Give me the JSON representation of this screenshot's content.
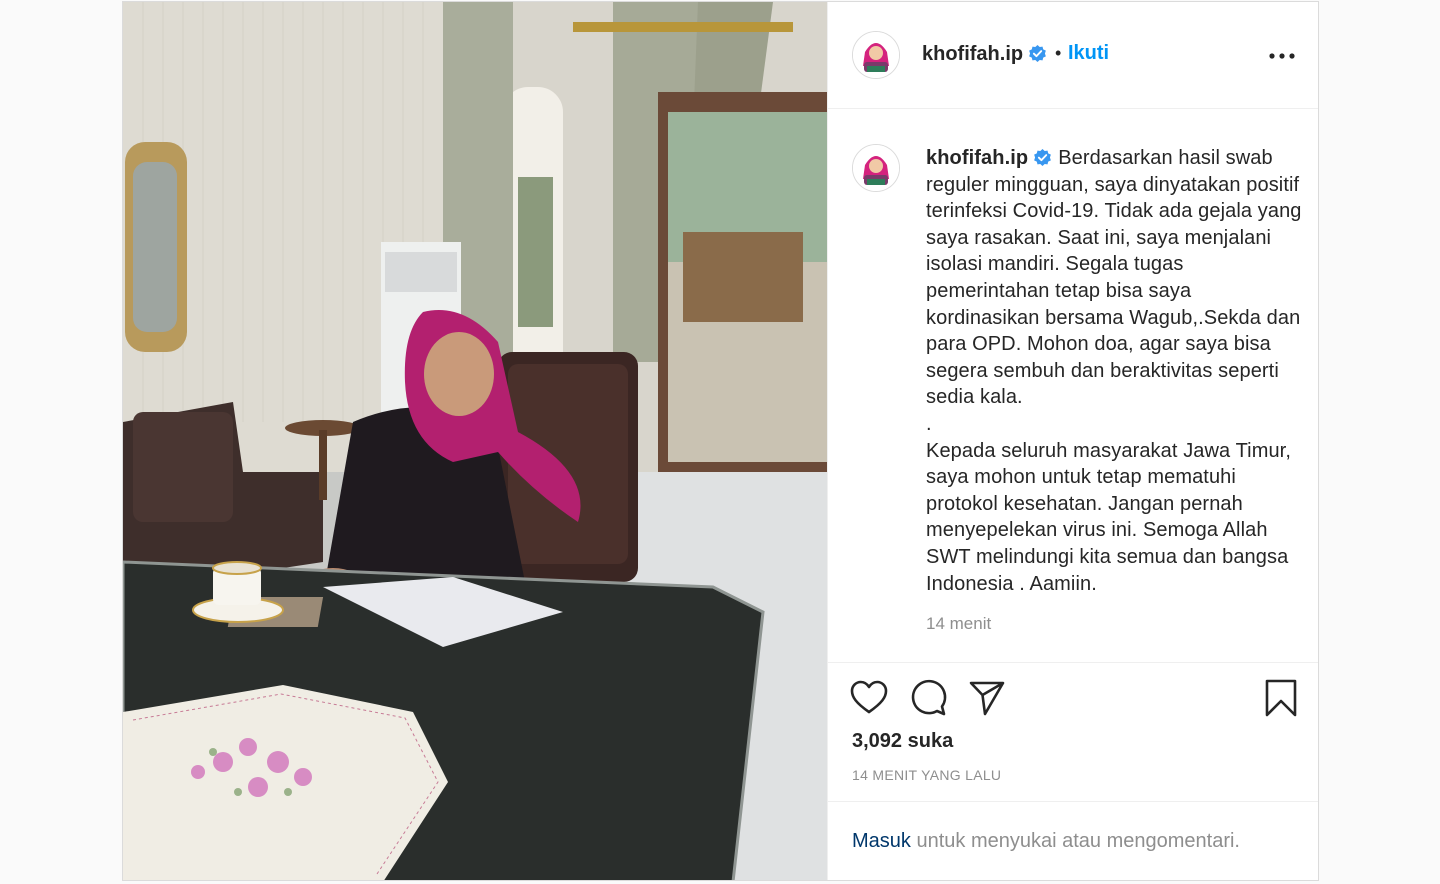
{
  "header": {
    "username": "khofifah.ip",
    "separator": "•",
    "follow_label": "Ikuti",
    "more_icon": "more-horizontal-icon"
  },
  "caption": {
    "username": "khofifah.ip",
    "paragraph1": "Berdasarkan hasil swab reguler mingguan, saya dinyatakan positif terinfeksi Covid-19. Tidak ada gejala yang saya rasakan. Saat ini, saya menjalani isolasi mandiri. Segala tugas pemerintahan tetap bisa saya kordinasikan bersama Wagub,.Sekda dan para OPD. Mohon doa, agar saya bisa segera sembuh dan beraktivitas seperti sedia kala.",
    "dot": ".",
    "paragraph2": "Kepada seluruh masyarakat Jawa Timur, saya mohon untuk tetap mematuhi protokol kesehatan. Jangan pernah menyepelekan virus ini. Semoga Allah SWT melindungi kita semua dan bangsa Indonesia . Aamiin.",
    "time": "14 menit"
  },
  "actions": {
    "like_icon": "heart-icon",
    "comment_icon": "comment-icon",
    "share_icon": "send-icon",
    "save_icon": "bookmark-icon",
    "likes": "3,092 suka",
    "posted": "14 MENIT YANG LALU"
  },
  "login": {
    "link": "Masuk",
    "text": " untuk menyukai atau mengomentari."
  },
  "colors": {
    "accent": "#0095f6",
    "link_dark": "#00376b",
    "muted": "#8e8e8e",
    "verified": "#3897f0"
  }
}
